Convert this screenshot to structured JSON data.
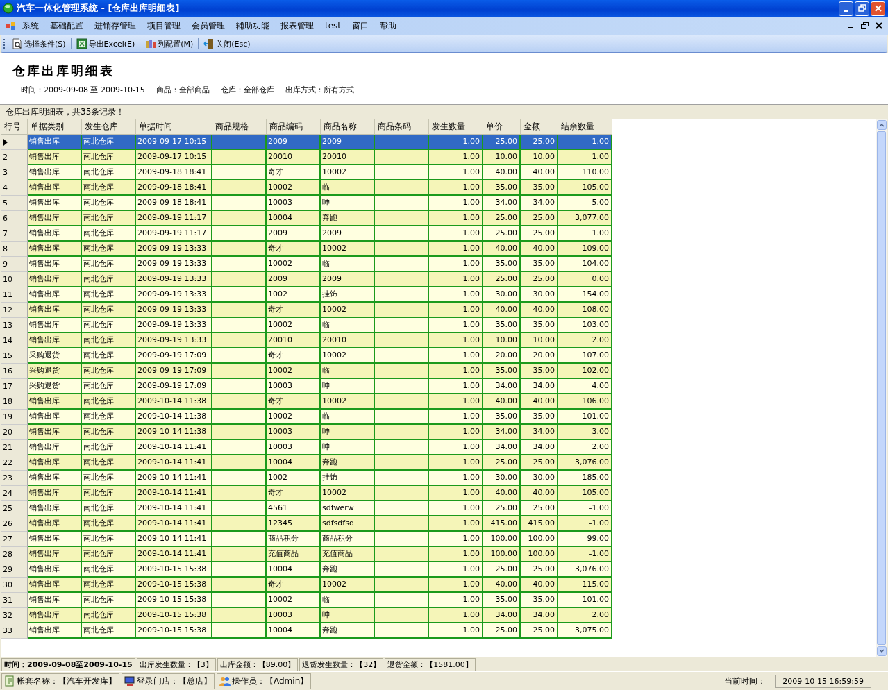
{
  "window": {
    "title": "汽车一体化管理系统 - [仓库出库明细表]"
  },
  "menu": [
    "系统",
    "基础配置",
    "进销存管理",
    "项目管理",
    "会员管理",
    "辅助功能",
    "报表管理",
    "test",
    "窗口",
    "帮助"
  ],
  "toolbar": [
    {
      "kind": "search",
      "label": "选择条件(S)"
    },
    {
      "kind": "excel",
      "label": "导出Excel(E)"
    },
    {
      "kind": "columns",
      "label": "列配置(M)"
    },
    {
      "kind": "exit",
      "label": "关闭(Esc)"
    }
  ],
  "report": {
    "title": "仓库出库明细表",
    "filters": [
      "时间：2009-09-08 至 2009-10-15",
      "商品：全部商品",
      "仓库：全部仓库",
      "出库方式：所有方式"
    ],
    "summary": "仓库出库明细表，共35条记录！"
  },
  "table": {
    "columns": [
      {
        "label": "行号",
        "kind": "index"
      },
      {
        "label": "单据类别",
        "kind": "text"
      },
      {
        "label": "发生仓库",
        "kind": "text"
      },
      {
        "label": "单据时间",
        "kind": "text"
      },
      {
        "label": "商品规格",
        "kind": "text"
      },
      {
        "label": "商品编码",
        "kind": "text"
      },
      {
        "label": "商品名称",
        "kind": "text"
      },
      {
        "label": "商品条码",
        "kind": "text"
      },
      {
        "label": "发生数量",
        "kind": "number"
      },
      {
        "label": "单价",
        "kind": "number"
      },
      {
        "label": "金额",
        "kind": "number"
      },
      {
        "label": "结余数量",
        "kind": "number"
      }
    ],
    "rows": [
      {
        "selected": true,
        "cells": [
          "",
          "销售出库",
          "南北仓库",
          "2009-09-17 10:15",
          "",
          "2009",
          "2009",
          "",
          "1.00",
          "25.00",
          "25.00",
          "1.00"
        ]
      },
      {
        "selected": false,
        "cells": [
          "2",
          "销售出库",
          "南北仓库",
          "2009-09-17 10:15",
          "",
          "20010",
          "20010",
          "",
          "1.00",
          "10.00",
          "10.00",
          "1.00"
        ]
      },
      {
        "selected": false,
        "cells": [
          "3",
          "销售出库",
          "南北仓库",
          "2009-09-18 18:41",
          "",
          "奇才",
          "10002",
          "",
          "1.00",
          "40.00",
          "40.00",
          "110.00"
        ]
      },
      {
        "selected": false,
        "cells": [
          "4",
          "销售出库",
          "南北仓库",
          "2009-09-18 18:41",
          "",
          "10002",
          "临",
          "",
          "1.00",
          "35.00",
          "35.00",
          "105.00"
        ]
      },
      {
        "selected": false,
        "cells": [
          "5",
          "销售出库",
          "南北仓库",
          "2009-09-18 18:41",
          "",
          "10003",
          "呻",
          "",
          "1.00",
          "34.00",
          "34.00",
          "5.00"
        ]
      },
      {
        "selected": false,
        "cells": [
          "6",
          "销售出库",
          "南北仓库",
          "2009-09-19 11:17",
          "",
          "10004",
          "奔跑",
          "",
          "1.00",
          "25.00",
          "25.00",
          "3,077.00"
        ]
      },
      {
        "selected": false,
        "cells": [
          "7",
          "销售出库",
          "南北仓库",
          "2009-09-19 11:17",
          "",
          "2009",
          "2009",
          "",
          "1.00",
          "25.00",
          "25.00",
          "1.00"
        ]
      },
      {
        "selected": false,
        "cells": [
          "8",
          "销售出库",
          "南北仓库",
          "2009-09-19 13:33",
          "",
          "奇才",
          "10002",
          "",
          "1.00",
          "40.00",
          "40.00",
          "109.00"
        ]
      },
      {
        "selected": false,
        "cells": [
          "9",
          "销售出库",
          "南北仓库",
          "2009-09-19 13:33",
          "",
          "10002",
          "临",
          "",
          "1.00",
          "35.00",
          "35.00",
          "104.00"
        ]
      },
      {
        "selected": false,
        "cells": [
          "10",
          "销售出库",
          "南北仓库",
          "2009-09-19 13:33",
          "",
          "2009",
          "2009",
          "",
          "1.00",
          "25.00",
          "25.00",
          "0.00"
        ]
      },
      {
        "selected": false,
        "cells": [
          "11",
          "销售出库",
          "南北仓库",
          "2009-09-19 13:33",
          "",
          "1002",
          "挂饰",
          "",
          "1.00",
          "30.00",
          "30.00",
          "154.00"
        ]
      },
      {
        "selected": false,
        "cells": [
          "12",
          "销售出库",
          "南北仓库",
          "2009-09-19 13:33",
          "",
          "奇才",
          "10002",
          "",
          "1.00",
          "40.00",
          "40.00",
          "108.00"
        ]
      },
      {
        "selected": false,
        "cells": [
          "13",
          "销售出库",
          "南北仓库",
          "2009-09-19 13:33",
          "",
          "10002",
          "临",
          "",
          "1.00",
          "35.00",
          "35.00",
          "103.00"
        ]
      },
      {
        "selected": false,
        "cells": [
          "14",
          "销售出库",
          "南北仓库",
          "2009-09-19 13:33",
          "",
          "20010",
          "20010",
          "",
          "1.00",
          "10.00",
          "10.00",
          "2.00"
        ]
      },
      {
        "selected": false,
        "cells": [
          "15",
          "采购退货",
          "南北仓库",
          "2009-09-19 17:09",
          "",
          "奇才",
          "10002",
          "",
          "1.00",
          "20.00",
          "20.00",
          "107.00"
        ]
      },
      {
        "selected": false,
        "cells": [
          "16",
          "采购退货",
          "南北仓库",
          "2009-09-19 17:09",
          "",
          "10002",
          "临",
          "",
          "1.00",
          "35.00",
          "35.00",
          "102.00"
        ]
      },
      {
        "selected": false,
        "cells": [
          "17",
          "采购退货",
          "南北仓库",
          "2009-09-19 17:09",
          "",
          "10003",
          "呻",
          "",
          "1.00",
          "34.00",
          "34.00",
          "4.00"
        ]
      },
      {
        "selected": false,
        "cells": [
          "18",
          "销售出库",
          "南北仓库",
          "2009-10-14 11:38",
          "",
          "奇才",
          "10002",
          "",
          "1.00",
          "40.00",
          "40.00",
          "106.00"
        ]
      },
      {
        "selected": false,
        "cells": [
          "19",
          "销售出库",
          "南北仓库",
          "2009-10-14 11:38",
          "",
          "10002",
          "临",
          "",
          "1.00",
          "35.00",
          "35.00",
          "101.00"
        ]
      },
      {
        "selected": false,
        "cells": [
          "20",
          "销售出库",
          "南北仓库",
          "2009-10-14 11:38",
          "",
          "10003",
          "呻",
          "",
          "1.00",
          "34.00",
          "34.00",
          "3.00"
        ]
      },
      {
        "selected": false,
        "cells": [
          "21",
          "销售出库",
          "南北仓库",
          "2009-10-14 11:41",
          "",
          "10003",
          "呻",
          "",
          "1.00",
          "34.00",
          "34.00",
          "2.00"
        ]
      },
      {
        "selected": false,
        "cells": [
          "22",
          "销售出库",
          "南北仓库",
          "2009-10-14 11:41",
          "",
          "10004",
          "奔跑",
          "",
          "1.00",
          "25.00",
          "25.00",
          "3,076.00"
        ]
      },
      {
        "selected": false,
        "cells": [
          "23",
          "销售出库",
          "南北仓库",
          "2009-10-14 11:41",
          "",
          "1002",
          "挂饰",
          "",
          "1.00",
          "30.00",
          "30.00",
          "185.00"
        ]
      },
      {
        "selected": false,
        "cells": [
          "24",
          "销售出库",
          "南北仓库",
          "2009-10-14 11:41",
          "",
          "奇才",
          "10002",
          "",
          "1.00",
          "40.00",
          "40.00",
          "105.00"
        ]
      },
      {
        "selected": false,
        "cells": [
          "25",
          "销售出库",
          "南北仓库",
          "2009-10-14 11:41",
          "",
          "4561",
          "sdfwerw",
          "",
          "1.00",
          "25.00",
          "25.00",
          "-1.00"
        ]
      },
      {
        "selected": false,
        "cells": [
          "26",
          "销售出库",
          "南北仓库",
          "2009-10-14 11:41",
          "",
          "12345",
          "sdfsdfsd",
          "",
          "1.00",
          "415.00",
          "415.00",
          "-1.00"
        ]
      },
      {
        "selected": false,
        "cells": [
          "27",
          "销售出库",
          "南北仓库",
          "2009-10-14 11:41",
          "",
          "商品积分",
          "商品积分",
          "",
          "1.00",
          "100.00",
          "100.00",
          "99.00"
        ]
      },
      {
        "selected": false,
        "cells": [
          "28",
          "销售出库",
          "南北仓库",
          "2009-10-14 11:41",
          "",
          "充值商品",
          "充值商品",
          "",
          "1.00",
          "100.00",
          "100.00",
          "-1.00"
        ]
      },
      {
        "selected": false,
        "cells": [
          "29",
          "销售出库",
          "南北仓库",
          "2009-10-15 15:38",
          "",
          "10004",
          "奔跑",
          "",
          "1.00",
          "25.00",
          "25.00",
          "3,076.00"
        ]
      },
      {
        "selected": false,
        "cells": [
          "30",
          "销售出库",
          "南北仓库",
          "2009-10-15 15:38",
          "",
          "奇才",
          "10002",
          "",
          "1.00",
          "40.00",
          "40.00",
          "115.00"
        ]
      },
      {
        "selected": false,
        "cells": [
          "31",
          "销售出库",
          "南北仓库",
          "2009-10-15 15:38",
          "",
          "10002",
          "临",
          "",
          "1.00",
          "35.00",
          "35.00",
          "101.00"
        ]
      },
      {
        "selected": false,
        "cells": [
          "32",
          "销售出库",
          "南北仓库",
          "2009-10-15 15:38",
          "",
          "10003",
          "呻",
          "",
          "1.00",
          "34.00",
          "34.00",
          "2.00"
        ]
      },
      {
        "selected": false,
        "cells": [
          "33",
          "销售出库",
          "南北仓库",
          "2009-10-15 15:38",
          "",
          "10004",
          "奔跑",
          "",
          "1.00",
          "25.00",
          "25.00",
          "3,075.00"
        ]
      }
    ]
  },
  "totals": [
    "时间：2009-09-08至2009-10-15",
    "出库发生数量：【3】",
    "出库金额：【89.00】",
    "退货发生数量：【32】",
    "退货金额：【1581.00】"
  ],
  "status_bar": {
    "items": [
      {
        "kind": "book",
        "label": "帐套名称：【汽车开发库】"
      },
      {
        "kind": "store",
        "label": "登录门店：【总店】"
      },
      {
        "kind": "users",
        "label": "操作员：【Admin】"
      }
    ],
    "time_label": "当前时间：",
    "time": "2009-10-15 16:59:59"
  }
}
